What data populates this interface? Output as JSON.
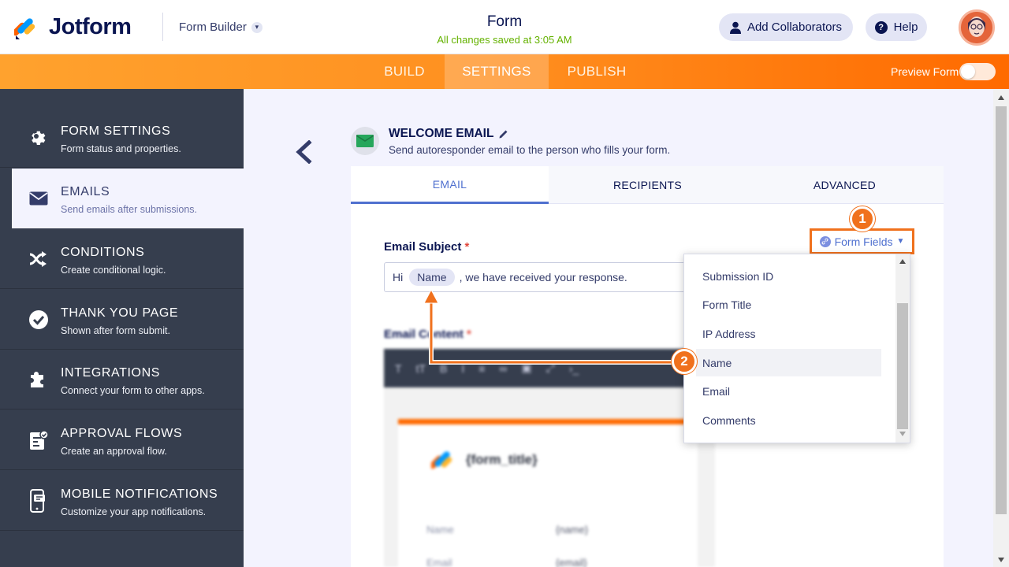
{
  "header": {
    "brand": "Jotform",
    "builder_select": "Form Builder",
    "form_title": "Form",
    "saved_status": "All changes saved at 3:05 AM",
    "add_collaborators": "Add Collaborators",
    "help": "Help"
  },
  "nav": {
    "tabs": [
      {
        "label": "BUILD",
        "active": false
      },
      {
        "label": "SETTINGS",
        "active": true
      },
      {
        "label": "PUBLISH",
        "active": false
      }
    ],
    "preview_label": "Preview Form",
    "preview_on": false
  },
  "sidebar": {
    "items": [
      {
        "title": "FORM SETTINGS",
        "sub": "Form status and properties.",
        "icon": "gear-icon"
      },
      {
        "title": "EMAILS",
        "sub": "Send emails after submissions.",
        "icon": "envelope-icon",
        "active": true
      },
      {
        "title": "CONDITIONS",
        "sub": "Create conditional logic.",
        "icon": "shuffle-icon"
      },
      {
        "title": "THANK YOU PAGE",
        "sub": "Shown after form submit.",
        "icon": "check-circle-icon"
      },
      {
        "title": "INTEGRATIONS",
        "sub": "Connect your form to other apps.",
        "icon": "puzzle-icon"
      },
      {
        "title": "APPROVAL FLOWS",
        "sub": "Create an approval flow.",
        "icon": "approval-icon"
      },
      {
        "title": "MOBILE NOTIFICATIONS",
        "sub": "Customize your app notifications.",
        "icon": "mobile-icon"
      }
    ]
  },
  "email_panel": {
    "title": "WELCOME EMAIL",
    "subtitle": "Send autoresponder email to the person who fills your form.",
    "tabs": [
      {
        "label": "EMAIL",
        "active": true
      },
      {
        "label": "RECIPIENTS",
        "active": false
      },
      {
        "label": "ADVANCED",
        "active": false
      }
    ],
    "subject_label": "Email Subject",
    "required_mark": "*",
    "subject_prefix": "Hi",
    "subject_tag": "Name",
    "subject_suffix": ", we have received your response.",
    "content_label": "Email Content",
    "form_fields_button": "Form Fields",
    "email_preview": {
      "title": "{form_title}",
      "rows": [
        {
          "label": "Name",
          "value": "{name}"
        },
        {
          "label": "Email",
          "value": "{email}"
        }
      ]
    }
  },
  "form_fields_dropdown": {
    "options": [
      "Submission ID",
      "Form Title",
      "IP Address",
      "Name",
      "Email",
      "Comments"
    ],
    "highlighted": "Name"
  },
  "callouts": [
    "1",
    "2"
  ],
  "colors": {
    "accent_orange": "#ff6a00",
    "sidebar_bg": "#363e4e",
    "link_blue": "#4f70cf",
    "saved_green": "#64b200"
  }
}
